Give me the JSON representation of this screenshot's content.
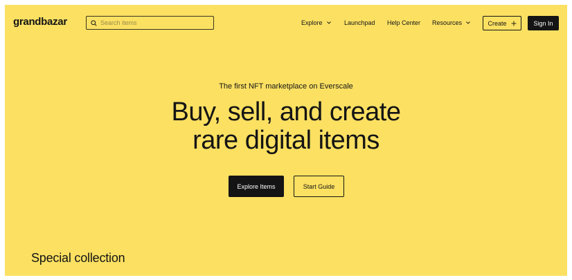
{
  "header": {
    "logo": "grandbazar",
    "search": {
      "placeholder": "Search items",
      "value": ""
    },
    "nav": {
      "explore": "Explore",
      "launchpad": "Launchpad",
      "help_center": "Help Center",
      "resources": "Resources"
    },
    "create_label": "Create",
    "sign_in_label": "Sign In"
  },
  "hero": {
    "tagline": "The first NFT marketplace on Everscale",
    "title_line1": "Buy, sell, and create",
    "title_line2": "rare digital items",
    "explore_button": "Explore Items",
    "guide_button": "Start Guide"
  },
  "sections": {
    "special_collection": "Special collection"
  },
  "icons": [
    "search-icon",
    "chevron-down-icon",
    "plus-icon"
  ],
  "colors": {
    "background": "#fbe062",
    "text": "#141414",
    "button_dark": "#141414",
    "button_text_light": "#ffffff"
  }
}
